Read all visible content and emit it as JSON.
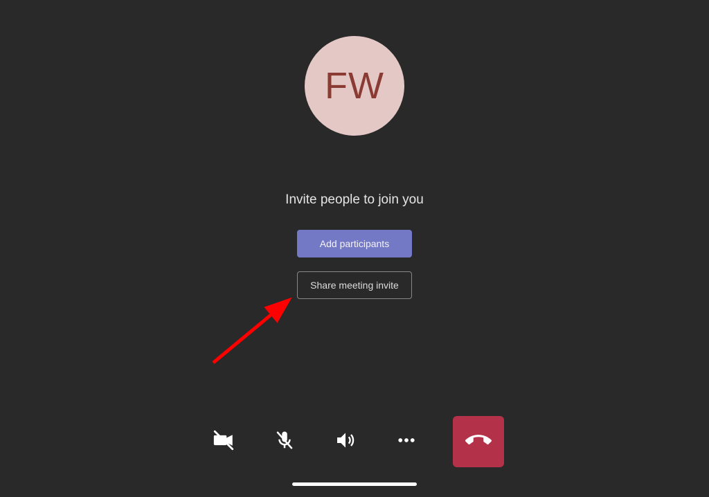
{
  "avatar": {
    "initials": "FW",
    "bg": "#e4c8c5",
    "fg": "#8a3b33"
  },
  "invite": {
    "heading": "Invite people to join you",
    "add_participants_label": "Add participants",
    "share_invite_label": "Share meeting invite"
  },
  "controls": {
    "camera": "camera-off",
    "mic": "mic-off",
    "speaker": "speaker",
    "more": "more",
    "hangup": "hangup"
  },
  "colors": {
    "accent": "#7479c6",
    "hangup": "#b4314a",
    "bg": "#292929"
  }
}
